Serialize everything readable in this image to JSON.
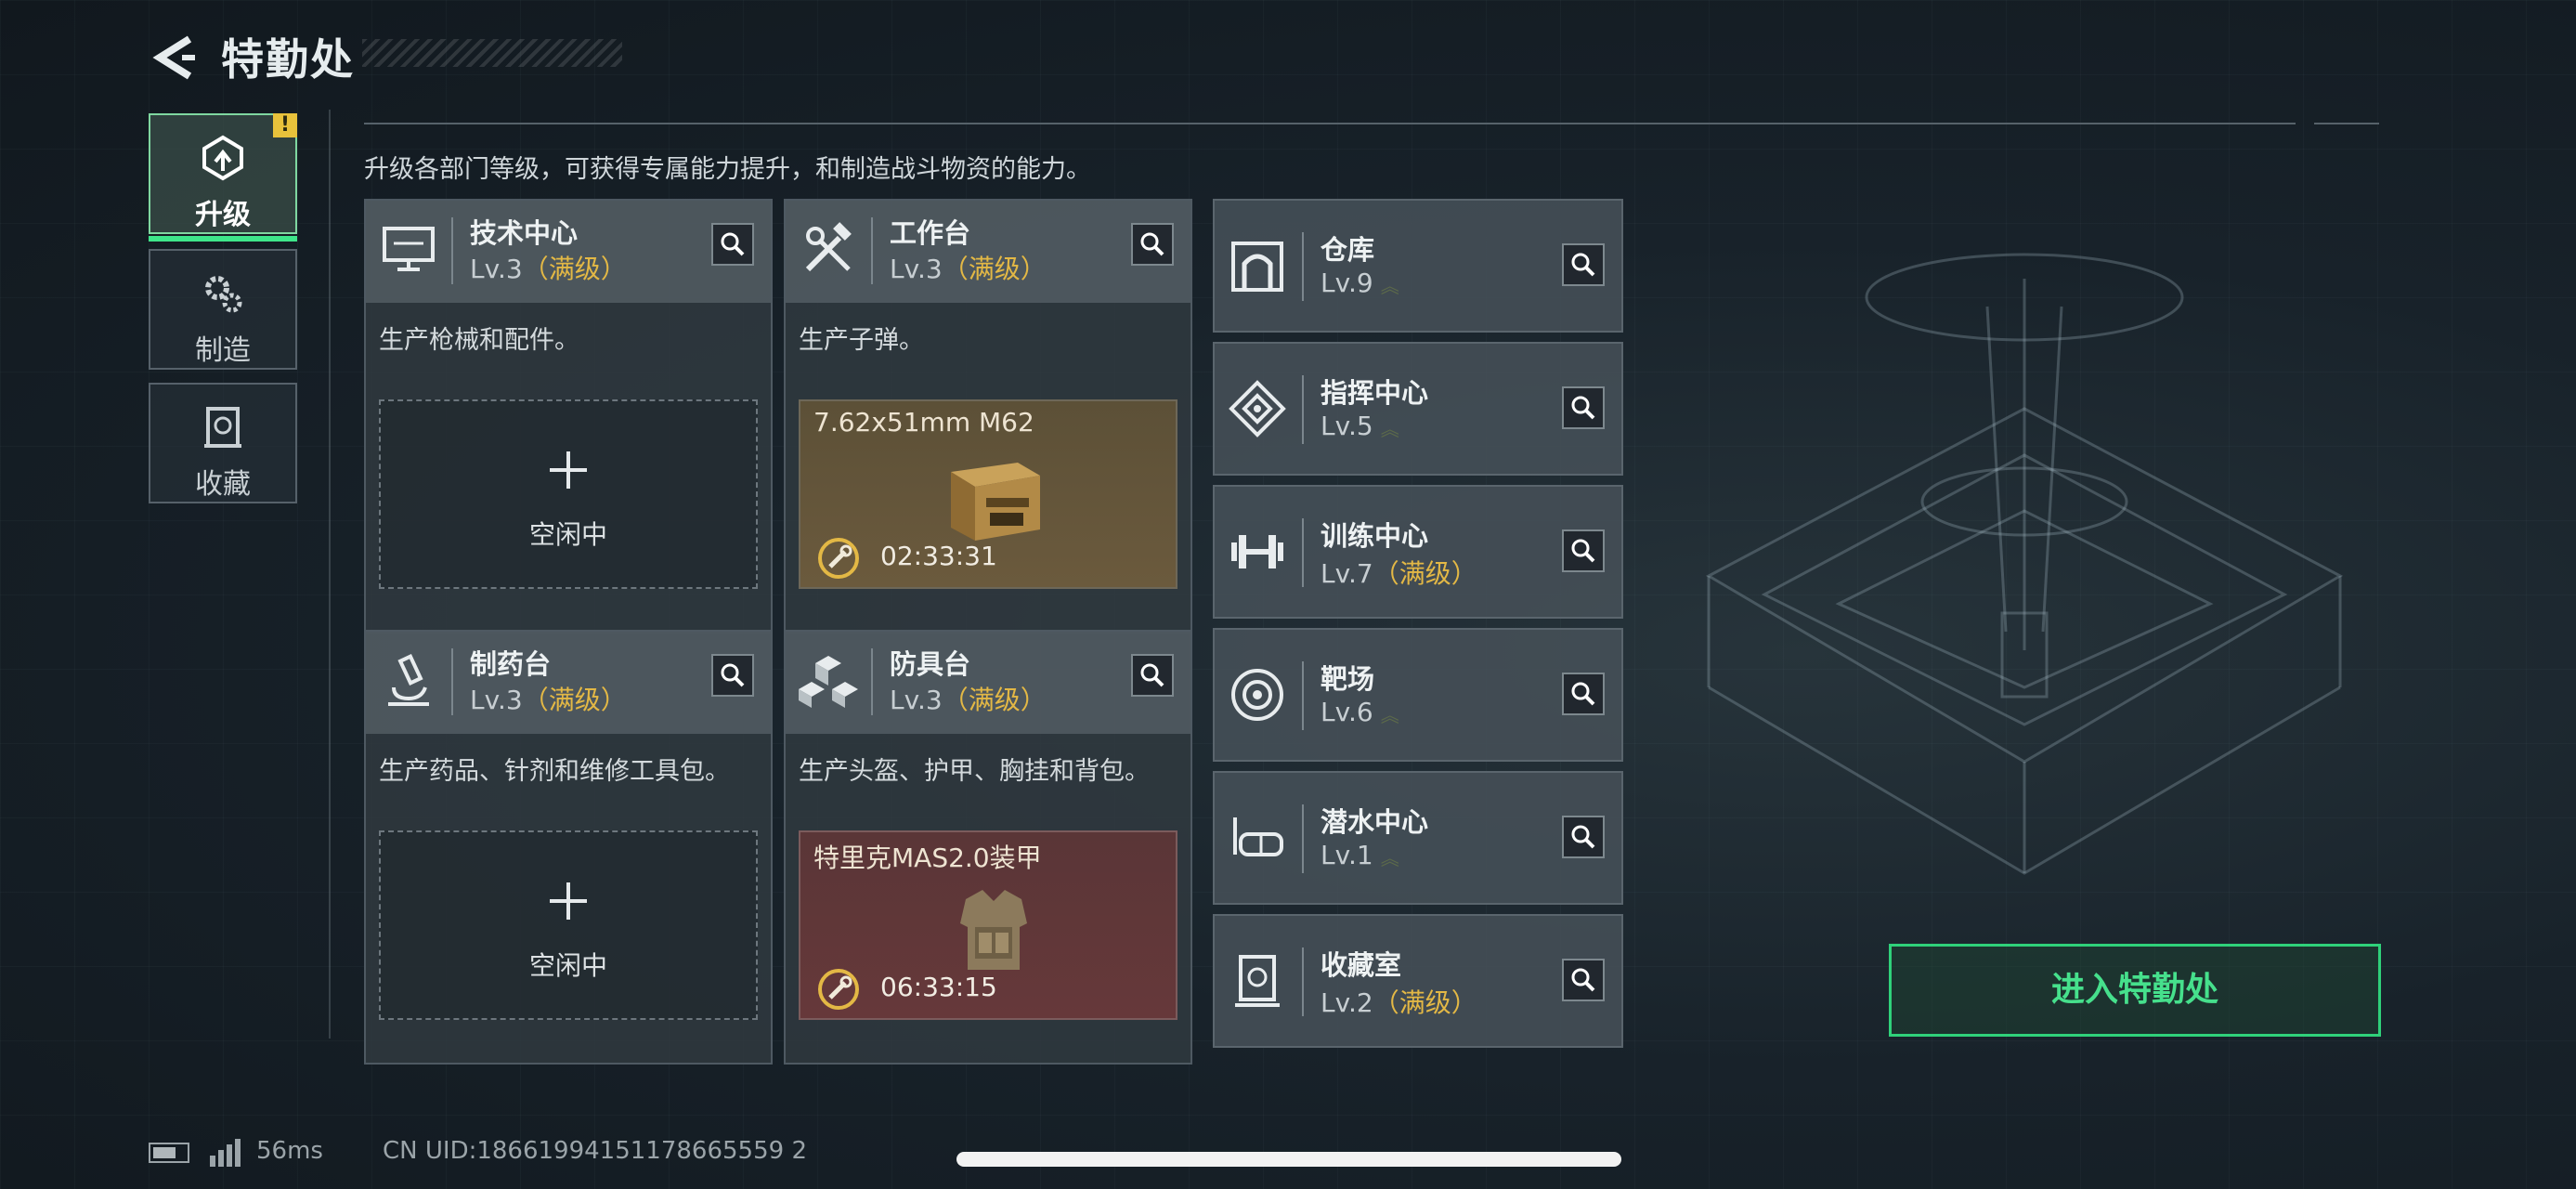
{
  "header": {
    "title": "特勤处"
  },
  "nav": [
    {
      "label": "升级",
      "icon": "upgrade-icon",
      "active": true,
      "alert": "!"
    },
    {
      "label": "制造",
      "icon": "gears-icon",
      "active": false
    },
    {
      "label": "收藏",
      "icon": "collection-icon",
      "active": false
    }
  ],
  "description": "升级各部门等级，可获得专属能力提升，和制造战斗物资的能力。",
  "cards": [
    {
      "name": "技术中心",
      "level": "Lv.3",
      "maxed": "（满级）",
      "desc": "生产枪械和配件。",
      "slot": {
        "state": "idle",
        "text": "空闲中"
      },
      "icon": "computer-icon"
    },
    {
      "name": "工作台",
      "level": "Lv.3",
      "maxed": "（满级）",
      "desc": "生产子弹。",
      "slot": {
        "state": "producing",
        "item": "7.62x51mm M62",
        "timer": "02:33:31"
      },
      "icon": "tools-icon"
    },
    {
      "name": "制药台",
      "level": "Lv.3",
      "maxed": "（满级）",
      "desc": "生产药品、针剂和维修工具包。",
      "slot": {
        "state": "idle",
        "text": "空闲中"
      },
      "icon": "microscope-icon"
    },
    {
      "name": "防具台",
      "level": "Lv.3",
      "maxed": "（满级）",
      "desc": "生产头盔、护甲、胸挂和背包。",
      "slot": {
        "state": "producing",
        "item": "特里克MAS2.0装甲",
        "timer": "06:33:15"
      },
      "icon": "cubes-icon"
    }
  ],
  "facilities": [
    {
      "name": "仓库",
      "level": "Lv.9",
      "maxed": "",
      "upgradable": true,
      "icon": "warehouse-icon"
    },
    {
      "name": "指挥中心",
      "level": "Lv.5",
      "maxed": "",
      "upgradable": true,
      "icon": "command-icon"
    },
    {
      "name": "训练中心",
      "level": "Lv.7",
      "maxed": "（满级）",
      "upgradable": false,
      "icon": "dumbbell-icon"
    },
    {
      "name": "靶场",
      "level": "Lv.6",
      "maxed": "",
      "upgradable": true,
      "icon": "target-icon"
    },
    {
      "name": "潜水中心",
      "level": "Lv.1",
      "maxed": "",
      "upgradable": true,
      "icon": "diving-mask-icon"
    },
    {
      "name": "收藏室",
      "level": "Lv.2",
      "maxed": "（满级）",
      "upgradable": false,
      "icon": "collection-room-icon"
    }
  ],
  "enter_button": "进入特勤处",
  "status": {
    "ping": "56ms",
    "uid": "CN UID:18661994151178665559 2"
  },
  "colors": {
    "accent": "#3ee68a",
    "maxed": "#e3b845"
  }
}
